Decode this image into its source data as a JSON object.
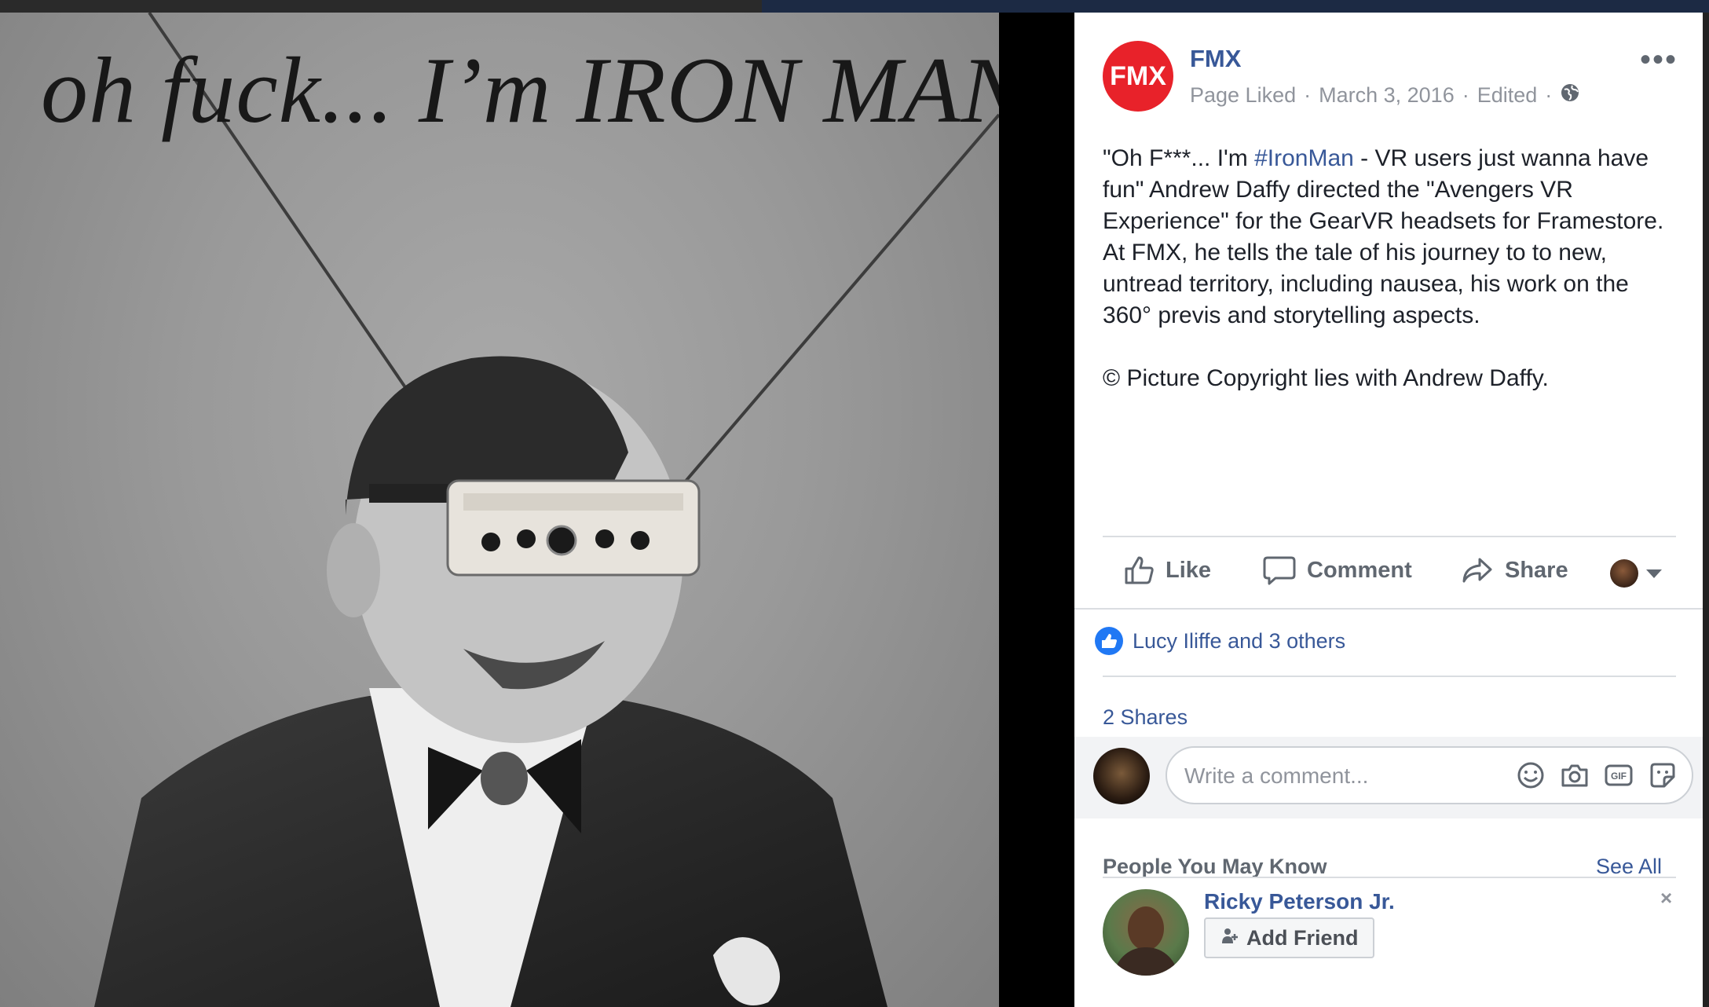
{
  "photo": {
    "caption": "oh fuck... I’m IRON MAN!"
  },
  "post": {
    "page_name": "FMX",
    "logo_text": "FMX",
    "meta": {
      "liked": "Page Liked",
      "date": "March 3, 2016",
      "edited": "Edited",
      "sep": "·"
    },
    "more_label": "•••",
    "body": {
      "part1": "\"Oh F***... I'm ",
      "hashtag": "#IronMan",
      "part2": " - VR users just wanna have fun\" Andrew Daffy directed the \"Avengers VR Experience\" for the GearVR headsets for Framestore. At FMX, he tells the tale of his journey to to new, untread territory, including nausea, his work on the 360° previs and storytelling aspects.",
      "copyright": "© Picture Copyright lies with Andrew Daffy."
    },
    "actions": {
      "like": "Like",
      "comment": "Comment",
      "share": "Share"
    },
    "reactions_text": "Lucy Iliffe and 3 others",
    "shares_text": "2 Shares",
    "comment_placeholder": "Write a comment...",
    "comment_icons": [
      "emoji-icon",
      "camera-icon",
      "gif-icon",
      "sticker-icon"
    ]
  },
  "people_you_may_know": {
    "title": "People You May Know",
    "see_all": "See All",
    "suggestions": [
      {
        "name": "Ricky Peterson Jr.",
        "button": "Add Friend",
        "close": "×"
      }
    ]
  },
  "colors": {
    "brand_red": "#e8222a",
    "link_blue": "#385898",
    "like_blue": "#2078f4",
    "muted_gray": "#90949c"
  }
}
